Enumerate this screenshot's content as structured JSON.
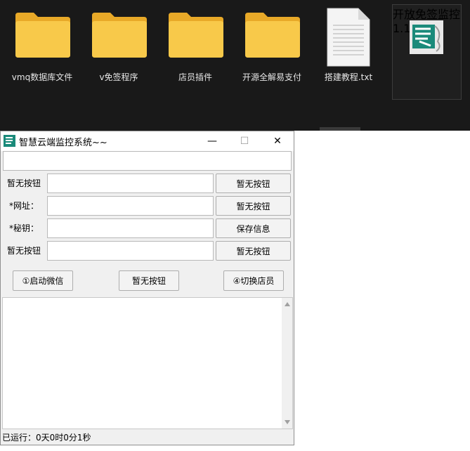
{
  "explorer": {
    "files": [
      {
        "name": "vmq数据库文件",
        "type": "folder"
      },
      {
        "name": "v免签程序",
        "type": "folder"
      },
      {
        "name": "店员插件",
        "type": "folder"
      },
      {
        "name": "开源全解易支付",
        "type": "folder"
      },
      {
        "name": "搭建教程.txt",
        "type": "text-file"
      },
      {
        "name_line1": "开放免签监控",
        "name_line2": "1.1.exe",
        "type": "exe"
      }
    ],
    "colors": {
      "background": "#191919",
      "folder": "#f6c342",
      "exe_icon": "#1a8a7a"
    }
  },
  "window": {
    "title": "智慧云端监控系统~~",
    "controls": {
      "minimize": "—",
      "maximize": "☐",
      "close": "✕"
    },
    "rows": [
      {
        "label": "暂无按钮",
        "button": "暂无按钮"
      },
      {
        "label": "*网址：",
        "button": "暂无按钮"
      },
      {
        "label": "*秘钥：",
        "button": "保存信息"
      },
      {
        "label": "暂无按钮",
        "button": "暂无按钮"
      }
    ],
    "actions": {
      "start_wechat": "①启动微信",
      "none": "暂无按钮",
      "switch_clerk": "④切换店员"
    },
    "status": "已运行：0天0时0分1秒"
  }
}
